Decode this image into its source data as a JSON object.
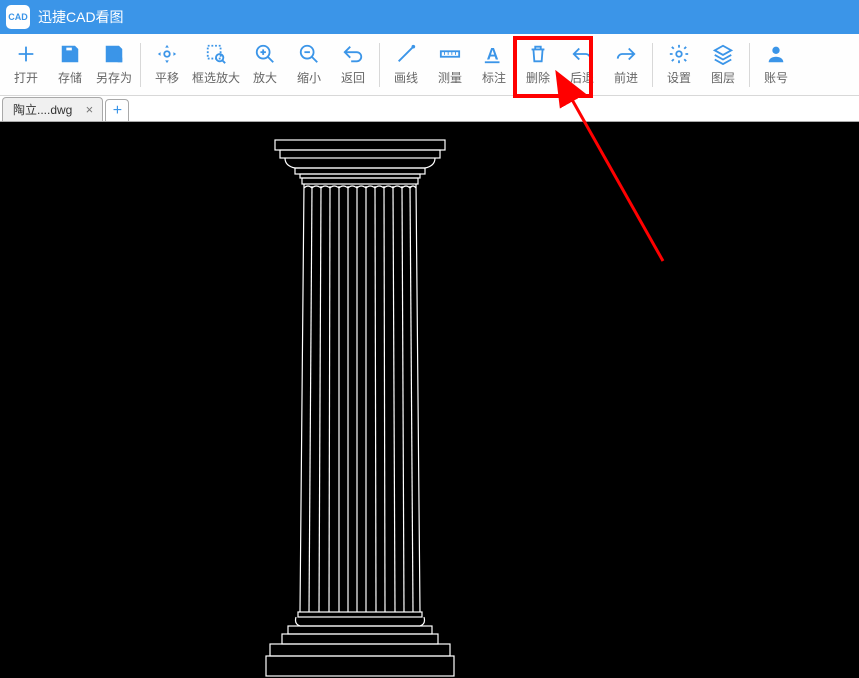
{
  "app": {
    "title": "迅捷CAD看图",
    "icon_label": "CAD"
  },
  "toolbar": {
    "groups": [
      [
        {
          "name": "open",
          "label": "打开",
          "icon": "plus"
        },
        {
          "name": "save",
          "label": "存储",
          "icon": "save"
        },
        {
          "name": "saveas",
          "label": "另存为",
          "icon": "saveas"
        }
      ],
      [
        {
          "name": "pan",
          "label": "平移",
          "icon": "pan"
        },
        {
          "name": "zoom-window",
          "label": "框选放大",
          "icon": "zoom-window",
          "wide": true
        },
        {
          "name": "zoom-in",
          "label": "放大",
          "icon": "zoom-in"
        },
        {
          "name": "zoom-out",
          "label": "缩小",
          "icon": "zoom-out"
        },
        {
          "name": "return",
          "label": "返回",
          "icon": "return"
        }
      ],
      [
        {
          "name": "line",
          "label": "画线",
          "icon": "line"
        },
        {
          "name": "measure",
          "label": "测量",
          "icon": "measure"
        },
        {
          "name": "annotate",
          "label": "标注",
          "icon": "annotate"
        },
        {
          "name": "delete",
          "label": "删除",
          "icon": "delete"
        },
        {
          "name": "undo",
          "label": "后退",
          "icon": "undo"
        },
        {
          "name": "redo",
          "label": "前进",
          "icon": "redo"
        }
      ],
      [
        {
          "name": "settings",
          "label": "设置",
          "icon": "gear"
        },
        {
          "name": "layers",
          "label": "图层",
          "icon": "layers"
        }
      ],
      [
        {
          "name": "account",
          "label": "账号",
          "icon": "user"
        }
      ]
    ]
  },
  "tabs": {
    "items": [
      {
        "label": "陶立....dwg"
      }
    ]
  },
  "annotation": {
    "highlight_target": "delete"
  }
}
